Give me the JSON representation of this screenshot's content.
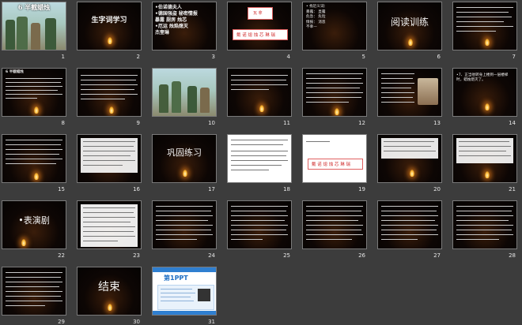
{
  "view": "slide-sorter",
  "slides": [
    {
      "n": "1",
      "title": "6 半截蜡烛"
    },
    {
      "n": "2",
      "title": "生字词学习"
    },
    {
      "n": "3",
      "lines": [
        "•伯诺德夫人",
        "•德国强盗 秘密情报",
        "暴露 厨房 烛芯",
        "•厄运 烛焰熄灭",
        "杰奎琳"
      ]
    },
    {
      "n": "4",
      "top_chars": "瓦 拿",
      "bottom_chars": "戴 诺 熄 烛 芯 琳 瑞"
    },
    {
      "n": "5",
      "lines": [
        "• 找近义词：",
        "暴露： 显露",
        "危急： 危险",
        "情报： 消息",
        "不幸—"
      ]
    },
    {
      "n": "6",
      "title": "阅读训练"
    },
    {
      "n": "7"
    },
    {
      "n": "8",
      "heading": "6  半截蜡烛"
    },
    {
      "n": "9"
    },
    {
      "n": "10"
    },
    {
      "n": "11"
    },
    {
      "n": "12"
    },
    {
      "n": "13"
    },
    {
      "n": "14",
      "text": "•7、正当他转身上楼到一层楼梯时，蜡烛熄灭了。"
    },
    {
      "n": "15"
    },
    {
      "n": "16"
    },
    {
      "n": "17",
      "title": "巩固练习"
    },
    {
      "n": "18"
    },
    {
      "n": "19",
      "bottom_chars": "戴 诺 熄 烛 芯 琳 瑞"
    },
    {
      "n": "20"
    },
    {
      "n": "21"
    },
    {
      "n": "22",
      "title": "•表演剧"
    },
    {
      "n": "23"
    },
    {
      "n": "24"
    },
    {
      "n": "25"
    },
    {
      "n": "26"
    },
    {
      "n": "27"
    },
    {
      "n": "28"
    },
    {
      "n": "29"
    },
    {
      "n": "30",
      "title": "结束"
    },
    {
      "n": "31",
      "brand": "第1PPT"
    }
  ]
}
